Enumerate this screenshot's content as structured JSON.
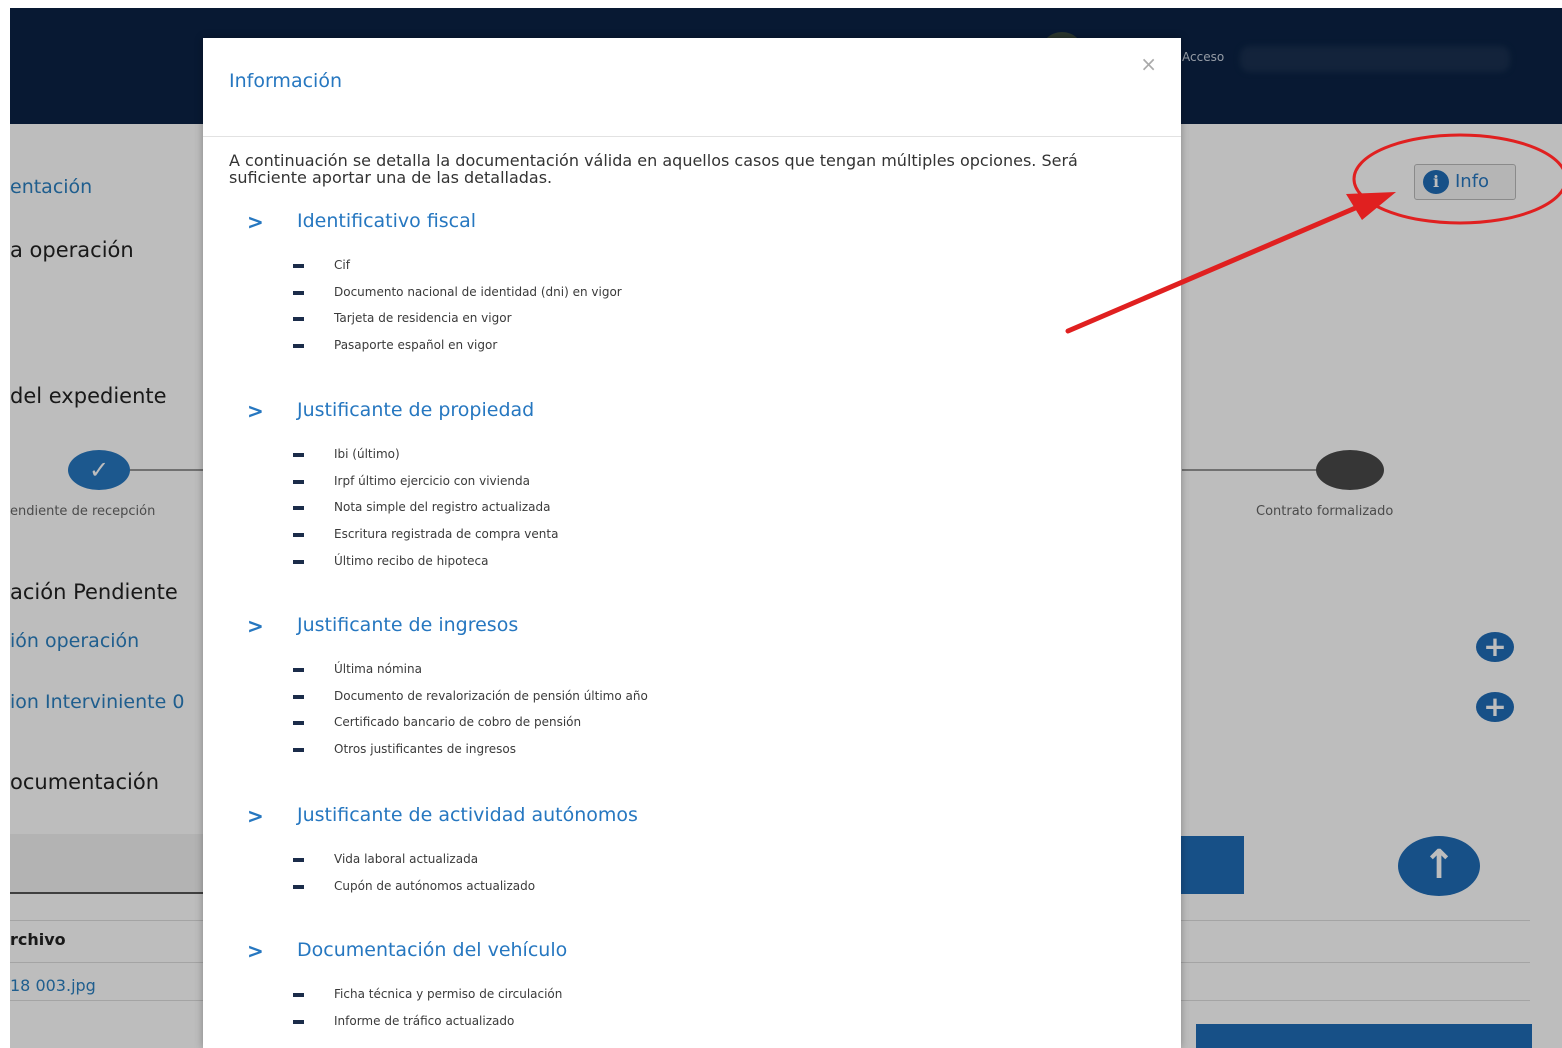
{
  "background": {
    "topbar": {
      "access_label": "Acceso"
    },
    "left_texts": {
      "documentacion_link": "entación",
      "operacion_heading": "a operación",
      "expediente_heading": "del expediente",
      "pendiente_label": "endiente de recepción",
      "pendiente_heading": "ación Pendiente",
      "operacion_link": "ión operación",
      "interviniente_link": "ion Interviniente 0",
      "documentacion_heading": "ocumentación",
      "archivo_header": "rchivo",
      "file_name": "18 003.jpg"
    },
    "step_check": "✓",
    "contrato_label": "Contrato formalizado",
    "plus_symbol": "+",
    "upload_symbol": "↑",
    "info_button": {
      "icon": "i",
      "label": "Info"
    }
  },
  "modal": {
    "title": "Información",
    "close": "×",
    "intro": "A continuación se detalla la documentación válida en aquellos casos que tengan múltiples opciones. Será suficiente aportar una de las detalladas.",
    "chevron": ">",
    "sections": [
      {
        "title": "Identificativo fiscal",
        "items": [
          "Cif",
          "Documento nacional de identidad (dni) en vigor",
          "Tarjeta de residencia en vigor",
          "Pasaporte español en vigor"
        ]
      },
      {
        "title": "Justificante de propiedad",
        "items": [
          "Ibi (último)",
          "Irpf último ejercicio con vivienda",
          "Nota simple del registro actualizada",
          "Escritura registrada de compra venta",
          "Último recibo de hipoteca"
        ]
      },
      {
        "title": "Justificante de ingresos",
        "items": [
          "Última nómina",
          "Documento de revalorización de pensión último año",
          "Certificado bancario de cobro de pensión",
          "Otros justificantes de ingresos"
        ]
      },
      {
        "title": "Justificante de actividad autónomos",
        "items": [
          "Vida laboral actualizada",
          "Cupón de autónomos actualizado"
        ]
      },
      {
        "title": "Documentación del vehículo",
        "items": [
          "Ficha técnica y permiso de circulación",
          "Informe de tráfico actualizado"
        ]
      }
    ]
  },
  "colors": {
    "accent": "#2677c0",
    "topbar": "#0b2345",
    "annotation": "#e02020"
  }
}
